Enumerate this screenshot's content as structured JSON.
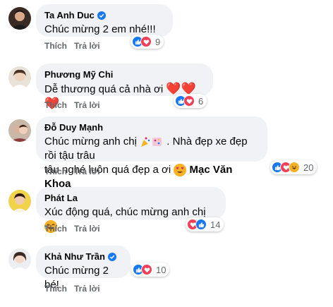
{
  "actions": {
    "like": "Thích",
    "reply": "Trả lời"
  },
  "colors": {
    "bubble": "#f0f2f5",
    "like": "#1877f2",
    "love": "#f33e58",
    "haha": "#f7b125",
    "meta": "#65676b"
  },
  "comments": [
    {
      "name": "Ta Anh Duc",
      "verified": true,
      "text": "Chúc mừng 2 em nhé!!!",
      "reactions": [
        "like",
        "love"
      ],
      "count": "9"
    },
    {
      "name": "Phương Mỹ Chi",
      "verified": false,
      "text": "Dễ thương quá cả nhà ơi",
      "emoji_suffix": "❤️❤️❤️",
      "reactions": [
        "like",
        "love"
      ],
      "count": "6"
    },
    {
      "name": "Đỗ Duy Mạnh",
      "verified": false,
      "text_line1": "Chúc mừng anh chị",
      "text_line1_after": ". Nhà đẹp xe đẹp rồi tậu trâu",
      "text_line2": "tậu nghé luôn quá đẹp a ơi",
      "mention": "Mạc Văn Khoa",
      "reactions": [
        "like",
        "love",
        "haha"
      ],
      "count": "20"
    },
    {
      "name": "Phát La",
      "verified": false,
      "text": "Xúc động quá, chúc mừng anh chị",
      "reactions": [
        "love",
        "like"
      ],
      "count": "14"
    },
    {
      "name": "Khả Như Trần",
      "verified": true,
      "text": "Chúc mừng 2 bé!",
      "reactions": [
        "like",
        "love"
      ],
      "count": "10"
    }
  ]
}
